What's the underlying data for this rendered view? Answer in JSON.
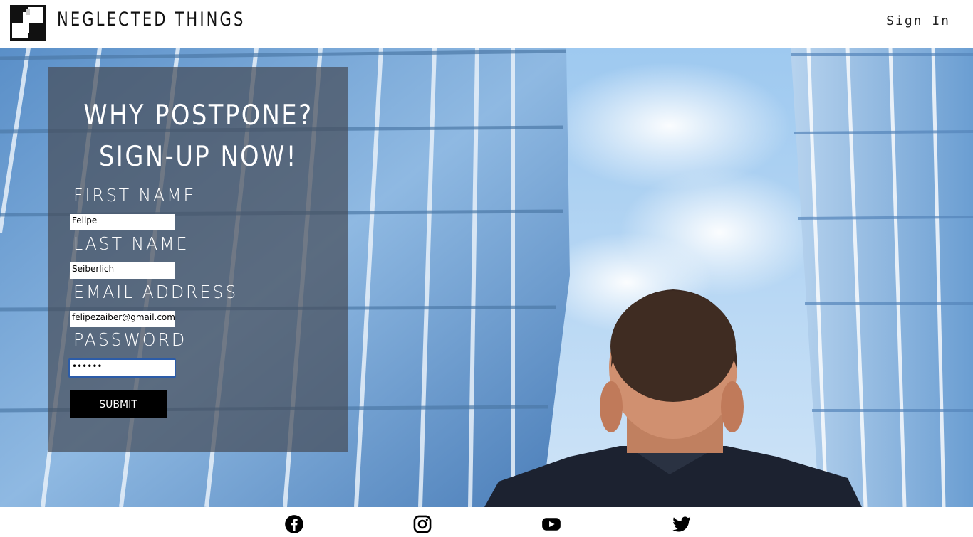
{
  "header": {
    "brand": "NEGLECTED THINGS",
    "sign_in": "Sign In"
  },
  "hero": {
    "headline_line1": "WHY POSTPONE?",
    "headline_line2": "SIGN-UP NOW!"
  },
  "form": {
    "first_name_label": "FIRST NAME",
    "first_name_value": "Felipe",
    "last_name_label": "LAST NAME",
    "last_name_value": "Seiberlich",
    "email_label": "EMAIL ADDRESS",
    "email_value": "felipezaiber@gmail.com",
    "password_label": "PASSWORD",
    "password_value": "••••••",
    "submit_label": "SUBMIT"
  },
  "footer": {
    "icons": [
      "facebook-icon",
      "instagram-icon",
      "youtube-icon",
      "twitter-icon"
    ]
  },
  "colors": {
    "panel": "#464e5a",
    "submit": "#000000",
    "focus_border": "#2c5ca8"
  }
}
